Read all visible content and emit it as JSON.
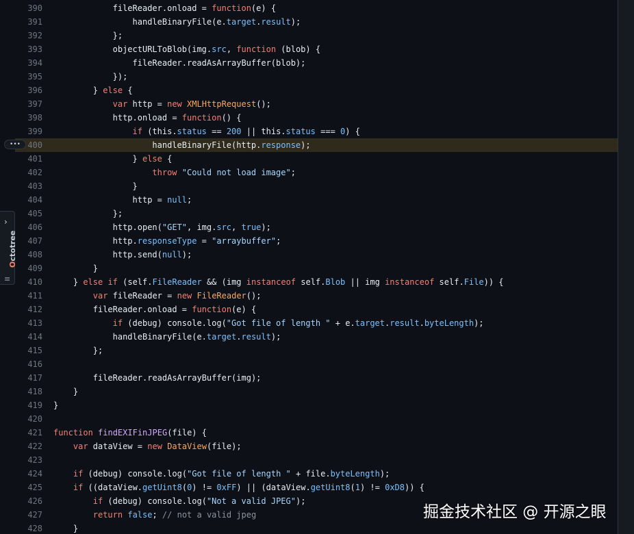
{
  "sidebar": {
    "name": "Octotree",
    "chevron": "›",
    "menu_icon": "≡"
  },
  "gutter": {
    "expand_button": "•••"
  },
  "watermark": "掘金技术社区 @ 开源之眼",
  "colors": {
    "background": "#0d1117",
    "keyword": "#ff7b72",
    "string": "#a5d6ff",
    "function": "#d2a8ff",
    "property": "#79c0ff",
    "comment": "#8b949e",
    "highlight_line": "#2f2a1c"
  },
  "highlighted_line": "400",
  "code_lines": [
    {
      "n": "390",
      "indent": 6,
      "t": [
        [
          "fileReader.onload = ",
          ""
        ],
        [
          "function",
          "k"
        ],
        [
          "(e) {",
          ""
        ]
      ]
    },
    {
      "n": "391",
      "indent": 8,
      "t": [
        [
          "handleBinaryFile(e.",
          ""
        ],
        [
          "target",
          "p"
        ],
        [
          ".",
          ""
        ],
        [
          "result",
          "p"
        ],
        [
          ");",
          ""
        ]
      ]
    },
    {
      "n": "392",
      "indent": 6,
      "t": [
        [
          "};",
          ""
        ]
      ]
    },
    {
      "n": "393",
      "indent": 6,
      "t": [
        [
          "objectURLToBlob(img.",
          ""
        ],
        [
          "src",
          "p"
        ],
        [
          ", ",
          ""
        ],
        [
          "function",
          "k"
        ],
        [
          " (blob) {",
          ""
        ]
      ]
    },
    {
      "n": "394",
      "indent": 8,
      "t": [
        [
          "fileReader.readAsArrayBuffer(blob);",
          ""
        ]
      ]
    },
    {
      "n": "395",
      "indent": 6,
      "t": [
        [
          "});",
          ""
        ]
      ]
    },
    {
      "n": "396",
      "indent": 4,
      "t": [
        [
          "} ",
          ""
        ],
        [
          "else",
          "k"
        ],
        [
          " {",
          ""
        ]
      ]
    },
    {
      "n": "397",
      "indent": 6,
      "t": [
        [
          "var",
          "k"
        ],
        [
          " http = ",
          ""
        ],
        [
          "new",
          "k"
        ],
        [
          " ",
          ""
        ],
        [
          "XMLHttpRequest",
          "t"
        ],
        [
          "();",
          ""
        ]
      ]
    },
    {
      "n": "398",
      "indent": 6,
      "t": [
        [
          "http.onload = ",
          ""
        ],
        [
          "function",
          "k"
        ],
        [
          "() {",
          ""
        ]
      ]
    },
    {
      "n": "399",
      "indent": 8,
      "t": [
        [
          "if",
          "k"
        ],
        [
          " (this.",
          ""
        ],
        [
          "status",
          "p"
        ],
        [
          " == ",
          ""
        ],
        [
          "200",
          "p"
        ],
        [
          " || this.",
          ""
        ],
        [
          "status",
          "p"
        ],
        [
          " === ",
          ""
        ],
        [
          "0",
          "p"
        ],
        [
          ") {",
          ""
        ]
      ]
    },
    {
      "n": "400",
      "indent": 10,
      "t": [
        [
          "handleBinaryFile(http.",
          ""
        ],
        [
          "response",
          "p"
        ],
        [
          ");",
          ""
        ]
      ]
    },
    {
      "n": "401",
      "indent": 8,
      "t": [
        [
          "} ",
          ""
        ],
        [
          "else",
          "k"
        ],
        [
          " {",
          ""
        ]
      ]
    },
    {
      "n": "402",
      "indent": 10,
      "t": [
        [
          "throw",
          "k"
        ],
        [
          " ",
          ""
        ],
        [
          "\"Could not load image\"",
          "s"
        ],
        [
          ";",
          ""
        ]
      ]
    },
    {
      "n": "403",
      "indent": 8,
      "t": [
        [
          "}",
          ""
        ]
      ]
    },
    {
      "n": "404",
      "indent": 8,
      "t": [
        [
          "http = ",
          ""
        ],
        [
          "null",
          "p"
        ],
        [
          ";",
          ""
        ]
      ]
    },
    {
      "n": "405",
      "indent": 6,
      "t": [
        [
          "};",
          ""
        ]
      ]
    },
    {
      "n": "406",
      "indent": 6,
      "t": [
        [
          "http.open(",
          ""
        ],
        [
          "\"GET\"",
          "s"
        ],
        [
          ", img.",
          ""
        ],
        [
          "src",
          "p"
        ],
        [
          ", ",
          ""
        ],
        [
          "true",
          "p"
        ],
        [
          ");",
          ""
        ]
      ]
    },
    {
      "n": "407",
      "indent": 6,
      "t": [
        [
          "http.",
          ""
        ],
        [
          "responseType",
          "p"
        ],
        [
          " = ",
          ""
        ],
        [
          "\"arraybuffer\"",
          "s"
        ],
        [
          ";",
          ""
        ]
      ]
    },
    {
      "n": "408",
      "indent": 6,
      "t": [
        [
          "http.send(",
          ""
        ],
        [
          "null",
          "p"
        ],
        [
          ");",
          ""
        ]
      ]
    },
    {
      "n": "409",
      "indent": 4,
      "t": [
        [
          "}",
          ""
        ]
      ]
    },
    {
      "n": "410",
      "indent": 2,
      "t": [
        [
          "} ",
          ""
        ],
        [
          "else if",
          "k"
        ],
        [
          " (self.",
          ""
        ],
        [
          "FileReader",
          "p"
        ],
        [
          " && (img ",
          ""
        ],
        [
          "instanceof",
          "k"
        ],
        [
          " self.",
          ""
        ],
        [
          "Blob",
          "p"
        ],
        [
          " || img ",
          ""
        ],
        [
          "instanceof",
          "k"
        ],
        [
          " self.",
          ""
        ],
        [
          "File",
          "p"
        ],
        [
          ")) {",
          ""
        ]
      ]
    },
    {
      "n": "411",
      "indent": 4,
      "t": [
        [
          "var",
          "k"
        ],
        [
          " fileReader = ",
          ""
        ],
        [
          "new",
          "k"
        ],
        [
          " ",
          ""
        ],
        [
          "FileReader",
          "t"
        ],
        [
          "();",
          ""
        ]
      ]
    },
    {
      "n": "412",
      "indent": 4,
      "t": [
        [
          "fileReader.onload = ",
          ""
        ],
        [
          "function",
          "k"
        ],
        [
          "(e) {",
          ""
        ]
      ]
    },
    {
      "n": "413",
      "indent": 6,
      "t": [
        [
          "if",
          "k"
        ],
        [
          " (debug) console.log(",
          ""
        ],
        [
          "\"Got file of length \"",
          "s"
        ],
        [
          " + e.",
          ""
        ],
        [
          "target",
          "p"
        ],
        [
          ".",
          ""
        ],
        [
          "result",
          "p"
        ],
        [
          ".",
          ""
        ],
        [
          "byteLength",
          "p"
        ],
        [
          ");",
          ""
        ]
      ]
    },
    {
      "n": "414",
      "indent": 6,
      "t": [
        [
          "handleBinaryFile(e.",
          ""
        ],
        [
          "target",
          "p"
        ],
        [
          ".",
          ""
        ],
        [
          "result",
          "p"
        ],
        [
          ");",
          ""
        ]
      ]
    },
    {
      "n": "415",
      "indent": 4,
      "t": [
        [
          "};",
          ""
        ]
      ]
    },
    {
      "n": "416",
      "indent": 0,
      "t": []
    },
    {
      "n": "417",
      "indent": 4,
      "t": [
        [
          "fileReader.readAsArrayBuffer(img);",
          ""
        ]
      ]
    },
    {
      "n": "418",
      "indent": 2,
      "t": [
        [
          "}",
          ""
        ]
      ]
    },
    {
      "n": "419",
      "indent": 0,
      "t": [
        [
          "}",
          ""
        ]
      ]
    },
    {
      "n": "420",
      "indent": 0,
      "t": []
    },
    {
      "n": "421",
      "indent": 0,
      "t": [
        [
          "function",
          "k"
        ],
        [
          " ",
          ""
        ],
        [
          "findEXIFinJPEG",
          "f"
        ],
        [
          "(file) {",
          ""
        ]
      ]
    },
    {
      "n": "422",
      "indent": 2,
      "t": [
        [
          "var",
          "k"
        ],
        [
          " dataView = ",
          ""
        ],
        [
          "new",
          "k"
        ],
        [
          " ",
          ""
        ],
        [
          "DataView",
          "t"
        ],
        [
          "(file);",
          ""
        ]
      ]
    },
    {
      "n": "423",
      "indent": 0,
      "t": []
    },
    {
      "n": "424",
      "indent": 2,
      "t": [
        [
          "if",
          "k"
        ],
        [
          " (debug) console.log(",
          ""
        ],
        [
          "\"Got file of length \"",
          "s"
        ],
        [
          " + file.",
          ""
        ],
        [
          "byteLength",
          "p"
        ],
        [
          ");",
          ""
        ]
      ]
    },
    {
      "n": "425",
      "indent": 2,
      "t": [
        [
          "if",
          "k"
        ],
        [
          " ((dataView.",
          ""
        ],
        [
          "getUint8",
          "p"
        ],
        [
          "(",
          ""
        ],
        [
          "0",
          "p"
        ],
        [
          ") != ",
          ""
        ],
        [
          "0xFF",
          "p"
        ],
        [
          ") || (dataView.",
          ""
        ],
        [
          "getUint8",
          "p"
        ],
        [
          "(",
          ""
        ],
        [
          "1",
          "p"
        ],
        [
          ") != ",
          ""
        ],
        [
          "0xD8",
          "p"
        ],
        [
          ")) {",
          ""
        ]
      ]
    },
    {
      "n": "426",
      "indent": 4,
      "t": [
        [
          "if",
          "k"
        ],
        [
          " (debug) console.log(",
          ""
        ],
        [
          "\"Not a valid JPEG\"",
          "s"
        ],
        [
          ");",
          ""
        ]
      ]
    },
    {
      "n": "427",
      "indent": 4,
      "t": [
        [
          "return",
          "k"
        ],
        [
          " ",
          ""
        ],
        [
          "false",
          "p"
        ],
        [
          "; ",
          ""
        ],
        [
          "// not a valid jpeg",
          "c"
        ]
      ]
    },
    {
      "n": "428",
      "indent": 2,
      "t": [
        [
          "}",
          ""
        ]
      ]
    }
  ]
}
